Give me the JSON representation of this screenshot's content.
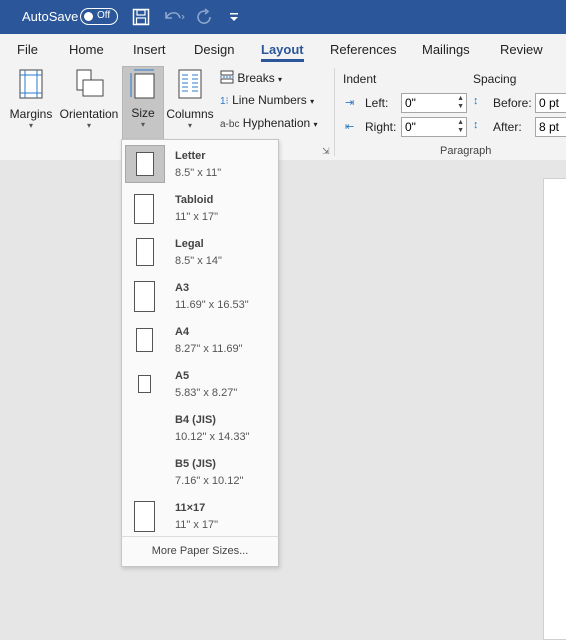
{
  "titlebar": {
    "autosave_label": "AutoSave",
    "autosave_state": "Off"
  },
  "tabs": [
    {
      "label": "File"
    },
    {
      "label": "Home"
    },
    {
      "label": "Insert"
    },
    {
      "label": "Design"
    },
    {
      "label": "Layout"
    },
    {
      "label": "References"
    },
    {
      "label": "Mailings"
    },
    {
      "label": "Review"
    }
  ],
  "ribbon": {
    "margins": "Margins",
    "orientation": "Orientation",
    "size": "Size",
    "columns": "Columns",
    "breaks": "Breaks",
    "line_numbers": "Line Numbers",
    "hyphenation": "Hyphenation",
    "indent": {
      "title": "Indent",
      "left_label": "Left:",
      "left_value": "0\"",
      "right_label": "Right:",
      "right_value": "0\""
    },
    "spacing": {
      "title": "Spacing",
      "before_label": "Before:",
      "before_value": "0 pt",
      "after_label": "After:",
      "after_value": "8 pt"
    },
    "paragraph_group": "Paragraph"
  },
  "size_menu": {
    "items": [
      {
        "name": "Letter",
        "dims": "8.5\" x 11\""
      },
      {
        "name": "Tabloid",
        "dims": "11\" x 17\""
      },
      {
        "name": "Legal",
        "dims": "8.5\" x 14\""
      },
      {
        "name": "A3",
        "dims": "11.69\" x 16.53\""
      },
      {
        "name": "A4",
        "dims": "8.27\" x 11.69\""
      },
      {
        "name": "A5",
        "dims": "5.83\" x 8.27\""
      },
      {
        "name": "B4 (JIS)",
        "dims": "10.12\" x 14.33\""
      },
      {
        "name": "B5 (JIS)",
        "dims": "7.16\" x 10.12\""
      },
      {
        "name": "11×17",
        "dims": "11\" x 17\""
      }
    ],
    "more": "More Paper Sizes..."
  }
}
